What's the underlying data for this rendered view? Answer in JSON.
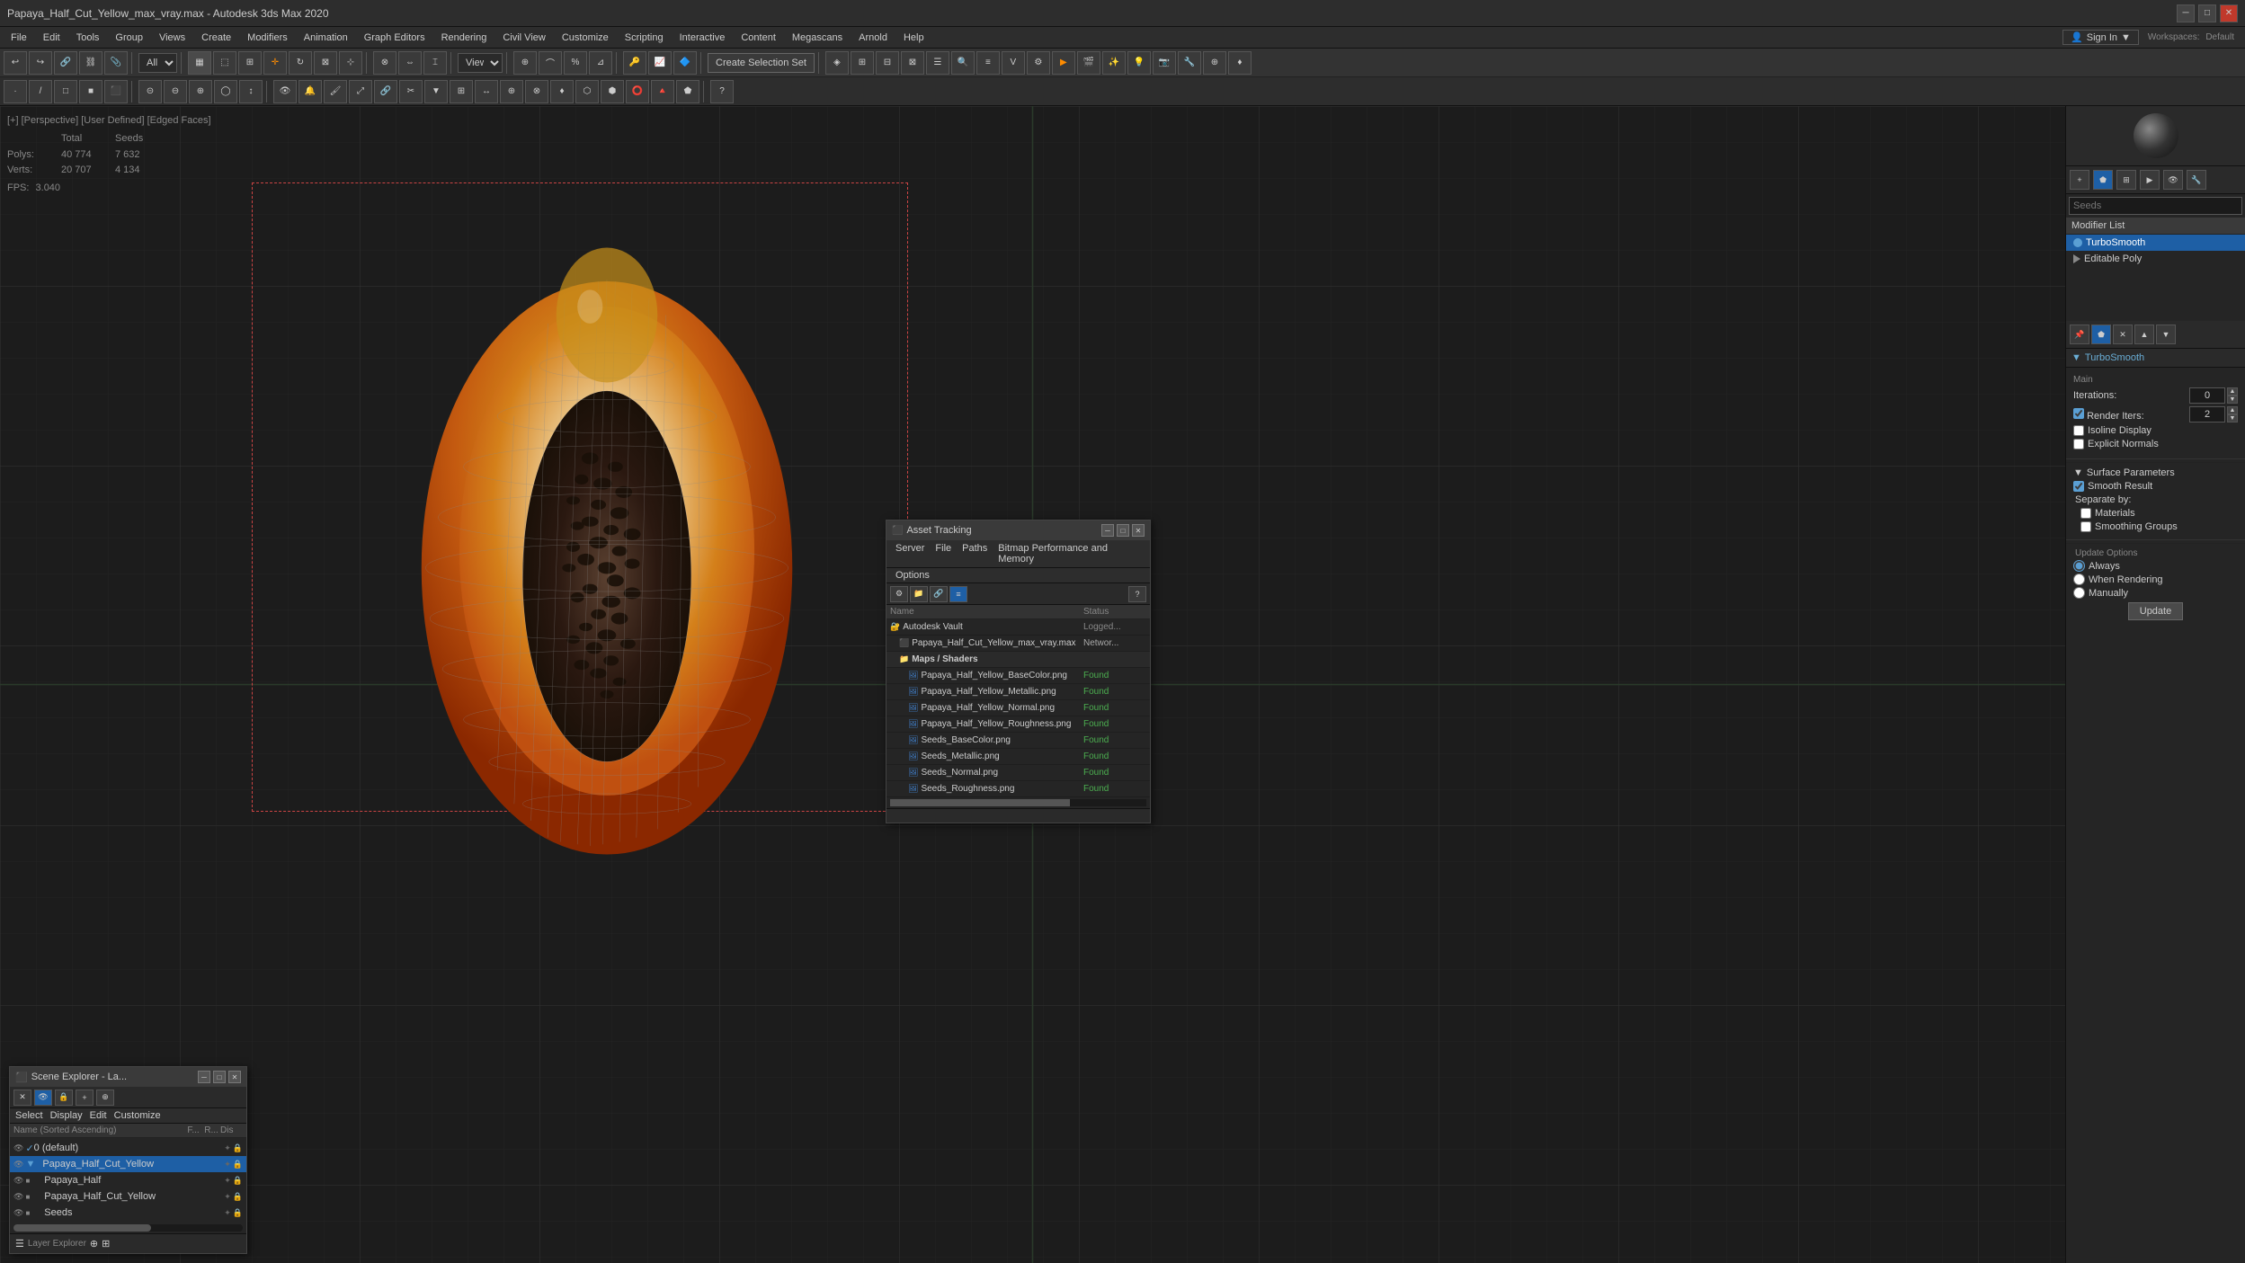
{
  "titlebar": {
    "title": "Papaya_Half_Cut_Yellow_max_vray.max - Autodesk 3ds Max 2020",
    "min_label": "─",
    "max_label": "□",
    "close_label": "✕"
  },
  "menubar": {
    "items": [
      "File",
      "Edit",
      "Tools",
      "Group",
      "Views",
      "Create",
      "Modifiers",
      "Animation",
      "Graph Editors",
      "Rendering",
      "Civil View",
      "Customize",
      "Scripting",
      "Interactive",
      "Content",
      "Megascans",
      "Arnold",
      "Help"
    ]
  },
  "toolbar": {
    "create_selection_set": "Create Selection Set",
    "view_dropdown": "View",
    "layer_dropdown": "All"
  },
  "viewport": {
    "info_text": "[+] [Perspective] [User Defined] [Edged Faces]",
    "stats": {
      "polys_label": "Polys:",
      "polys_total": "40 774",
      "polys_seeds": "7 632",
      "verts_label": "Verts:",
      "verts_total": "20 707",
      "verts_seeds": "4 134",
      "total_col": "Total",
      "seeds_col": "Seeds"
    },
    "fps_label": "FPS:",
    "fps_value": "3.040"
  },
  "right_panel": {
    "search_placeholder": "Seeds",
    "modifier_list_label": "Modifier List",
    "modifiers": [
      {
        "name": "TurboSmooth",
        "active": true
      },
      {
        "name": "Editable Poly",
        "active": false
      }
    ],
    "turbosmooth": {
      "title": "TurboSmooth",
      "section_main": "Main",
      "iterations_label": "Iterations:",
      "iterations_value": "0",
      "render_iters_label": "Render Iters:",
      "render_iters_value": "2",
      "isoline_display_label": "Isoline Display",
      "explicit_normals_label": "Explicit Normals",
      "surface_params_label": "Surface Parameters",
      "smooth_result_label": "Smooth Result",
      "smooth_result_checked": true,
      "separate_by_label": "Separate by:",
      "materials_label": "Materials",
      "smoothing_groups_label": "Smoothing Groups",
      "update_options_label": "Update Options",
      "always_label": "Always",
      "when_rendering_label": "When Rendering",
      "manually_label": "Manually",
      "update_btn": "Update"
    }
  },
  "scene_explorer": {
    "title": "Scene Explorer - La...",
    "menu_items": [
      "Select",
      "Display",
      "Edit",
      "Customize"
    ],
    "columns": {
      "name": "Name (Sorted Ascending)",
      "flags": "F...",
      "r": "R...",
      "dis": "Dis"
    },
    "items": [
      {
        "name": "0 (default)",
        "depth": 0,
        "type": "layer"
      },
      {
        "name": "Papaya_Half_Cut_Yellow",
        "depth": 1,
        "type": "group",
        "selected": true
      },
      {
        "name": "Papaya_Half",
        "depth": 2,
        "type": "mesh"
      },
      {
        "name": "Papaya_Half_Cut_Yellow",
        "depth": 2,
        "type": "mesh"
      },
      {
        "name": "Seeds",
        "depth": 2,
        "type": "mesh"
      }
    ],
    "footer_text": "Layer Explorer"
  },
  "asset_tracking": {
    "title": "Asset Tracking",
    "menu_items": [
      "Server",
      "File",
      "Paths",
      "Bitmap Performance and Memory",
      "Options"
    ],
    "columns": {
      "name": "Name",
      "status": "Status"
    },
    "items": [
      {
        "name": "Autodesk Vault",
        "status": "Logged...",
        "type": "vault",
        "depth": 0
      },
      {
        "name": "Papaya_Half_Cut_Yellow_max_vray.max",
        "status": "Networ...",
        "type": "max",
        "depth": 1
      },
      {
        "name": "Maps / Shaders",
        "status": "",
        "type": "folder",
        "depth": 1
      },
      {
        "name": "Papaya_Half_Yellow_BaseColor.png",
        "status": "Found",
        "type": "png",
        "depth": 2
      },
      {
        "name": "Papaya_Half_Yellow_Metallic.png",
        "status": "Found",
        "type": "png",
        "depth": 2
      },
      {
        "name": "Papaya_Half_Yellow_Normal.png",
        "status": "Found",
        "type": "png",
        "depth": 2
      },
      {
        "name": "Papaya_Half_Yellow_Roughness.png",
        "status": "Found",
        "type": "png",
        "depth": 2
      },
      {
        "name": "Seeds_BaseColor.png",
        "status": "Found",
        "type": "png",
        "depth": 2
      },
      {
        "name": "Seeds_Metallic.png",
        "status": "Found",
        "type": "png",
        "depth": 2
      },
      {
        "name": "Seeds_Normal.png",
        "status": "Found",
        "type": "png",
        "depth": 2
      },
      {
        "name": "Seeds_Roughness.png",
        "status": "Found",
        "type": "png",
        "depth": 2
      }
    ]
  },
  "workspaces": {
    "label": "Workspaces:",
    "value": "Default"
  },
  "signin": {
    "label": "Sign In"
  }
}
